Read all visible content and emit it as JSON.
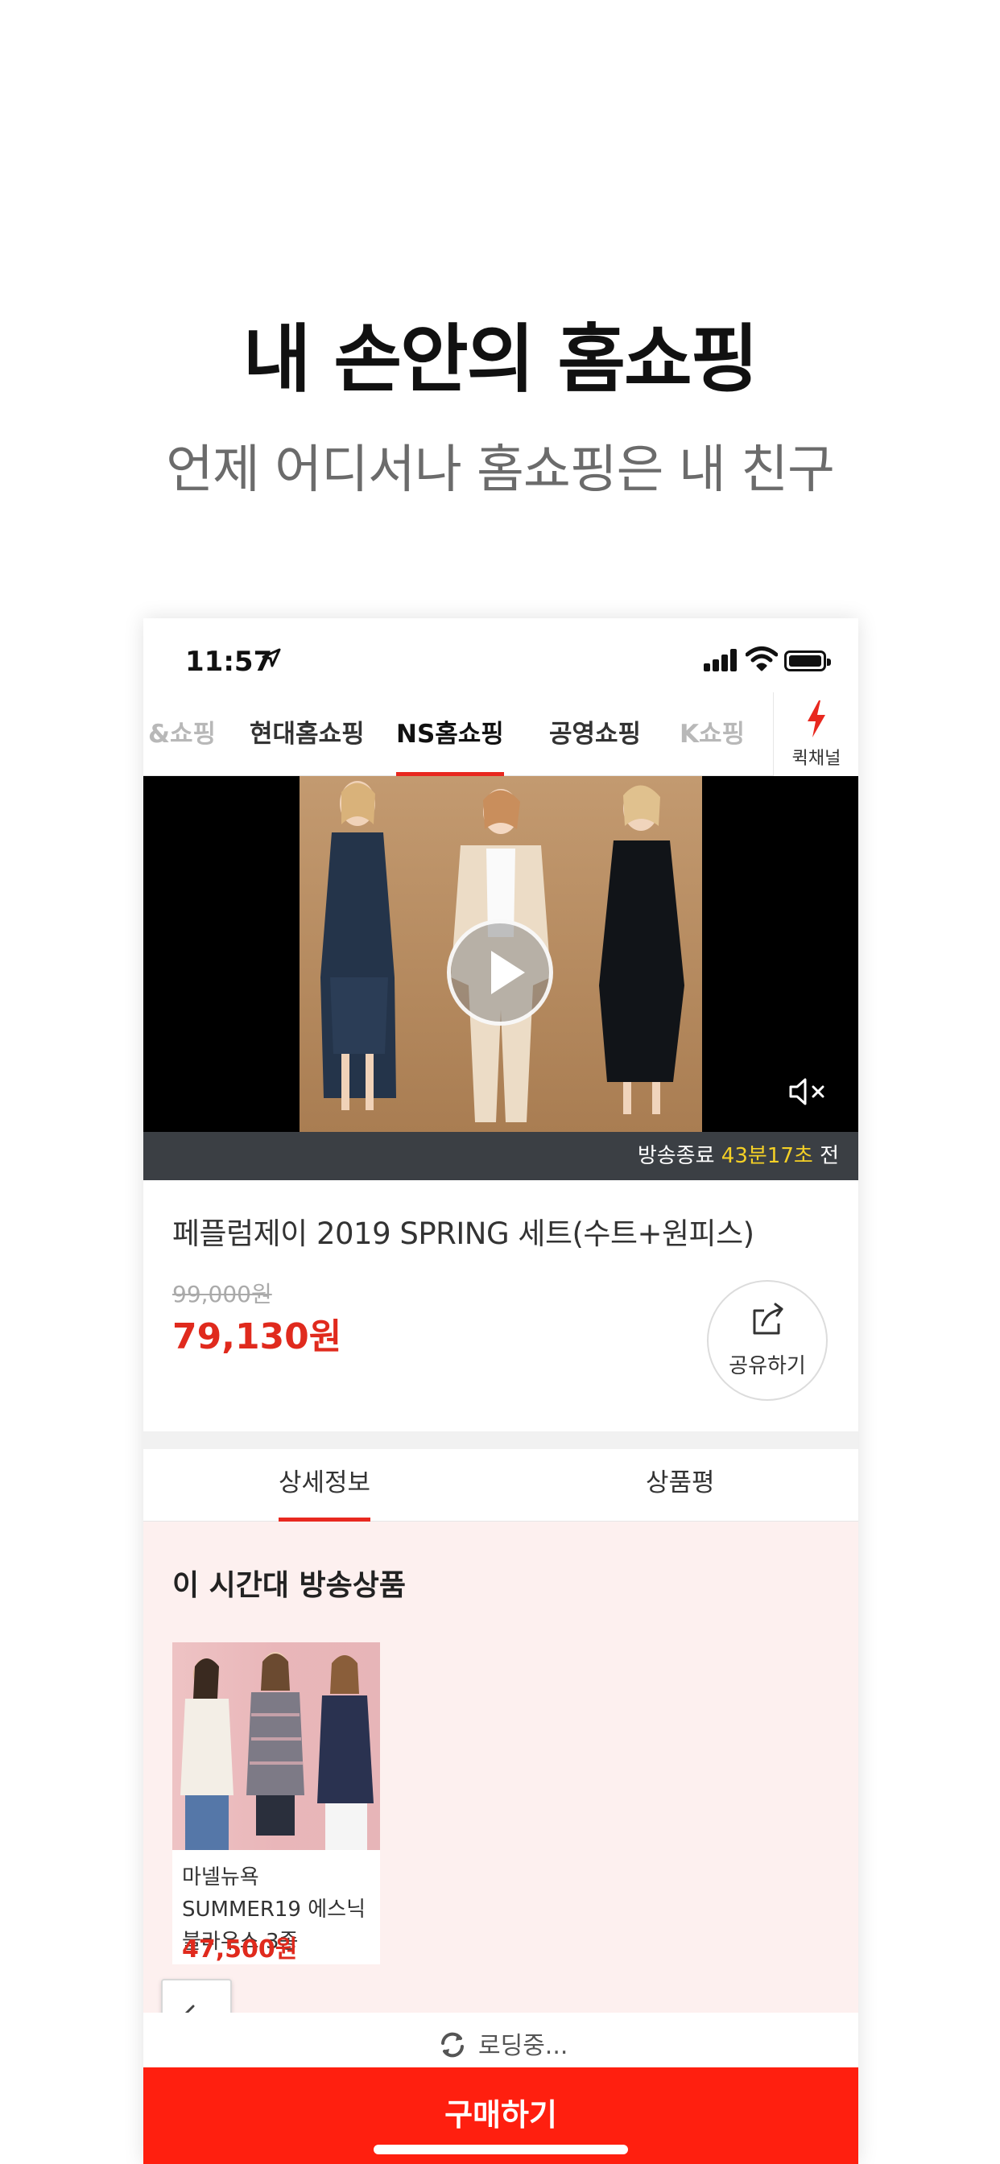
{
  "hero": {
    "title": "내 손안의 홈쇼핑",
    "subtitle": "언제 어디서나 홈쇼핑은 내 친구"
  },
  "status_bar": {
    "time": "11:57",
    "location_icon": "location-arrow-icon",
    "signal_icon": "cellular-signal-icon",
    "wifi_icon": "wifi-icon",
    "battery_icon": "battery-icon"
  },
  "channel_tabs": [
    {
      "label": "&쇼핑",
      "state": "partial"
    },
    {
      "label": "현대홈쇼핑",
      "state": "normal"
    },
    {
      "label": "NS홈쇼핑",
      "state": "active"
    },
    {
      "label": "공영쇼핑",
      "state": "normal"
    },
    {
      "label": "K쇼핑",
      "state": "faded"
    }
  ],
  "quick_channel": {
    "label": "퀵채널",
    "icon": "lightning-bolt-icon",
    "accent": "#e8281f"
  },
  "video": {
    "play_icon": "play-icon",
    "mute_icon": "muted-speaker-icon",
    "broadcast_prefix": "방송종료",
    "broadcast_remaining": "43분17초",
    "broadcast_suffix": "전"
  },
  "product": {
    "title": "페플럼제이 2019 SPRING 세트(수트+원피스)",
    "original_price": "99,000원",
    "sale_price": "79,130원",
    "share_label": "공유하기",
    "share_icon": "share-icon"
  },
  "detail_tabs": [
    {
      "label": "상세정보",
      "active": true
    },
    {
      "label": "상품평",
      "active": false
    }
  ],
  "on_air_section": {
    "title": "이 시간대 방송상품",
    "items": [
      {
        "name": "마넬뉴욕 SUMMER19 에스닉 블라우스 3종",
        "price": "47,500원"
      }
    ]
  },
  "loading": {
    "text": "로딩중...",
    "icon": "refresh-icon"
  },
  "buy_button": {
    "label": "구매하기"
  },
  "back_button": {
    "icon": "arrow-left-icon"
  },
  "colors": {
    "accent_red": "#e8281f",
    "price_red": "#e02a1d",
    "buy_red": "#ff1f0f",
    "countdown_yellow": "#f4d026",
    "section_bg": "#fdf0ef"
  }
}
